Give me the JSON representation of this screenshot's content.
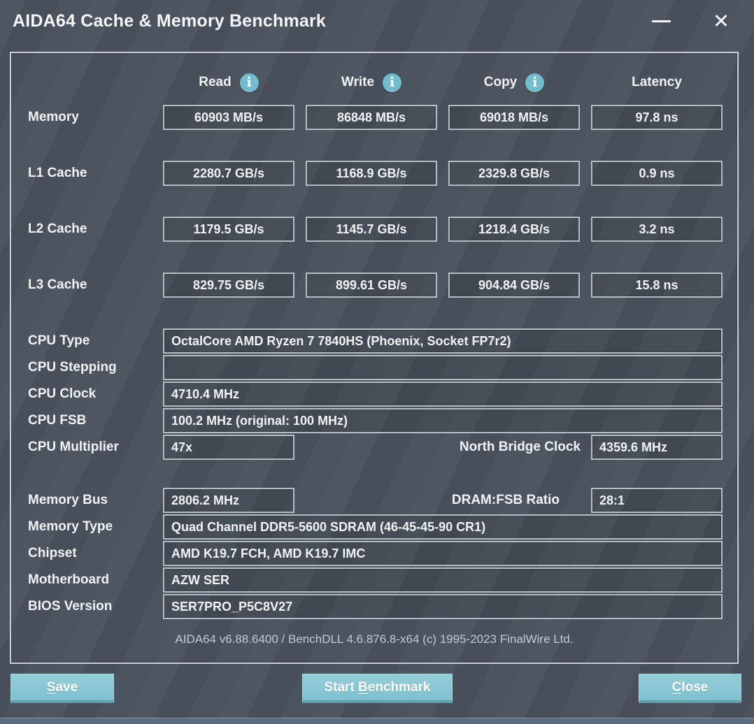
{
  "window": {
    "title": "AIDA64 Cache & Memory Benchmark"
  },
  "icons": {
    "info_glyph": "i",
    "close_glyph": "✕"
  },
  "colors": {
    "window_background": "#4a525d",
    "panel_border": "#ccd2d8",
    "box_border": "#b7bec6",
    "info_icon": "#72bccd",
    "button_teal": "#7fc1cf",
    "button_shadow": "#5f9fae",
    "text": "#f0f3f5",
    "credit_text": "#c3cad2"
  },
  "benchmark": {
    "columns": [
      {
        "label": "Read"
      },
      {
        "label": "Write"
      },
      {
        "label": "Copy"
      },
      {
        "label": "Latency"
      }
    ],
    "rows": [
      {
        "label": "Memory",
        "read": "60903 MB/s",
        "write": "86848 MB/s",
        "copy": "69018 MB/s",
        "latency": "97.8 ns"
      },
      {
        "label": "L1 Cache",
        "read": "2280.7 GB/s",
        "write": "1168.9 GB/s",
        "copy": "2329.8 GB/s",
        "latency": "0.9 ns"
      },
      {
        "label": "L2 Cache",
        "read": "1179.5 GB/s",
        "write": "1145.7 GB/s",
        "copy": "1218.4 GB/s",
        "latency": "3.2 ns"
      },
      {
        "label": "L3 Cache",
        "read": "829.75 GB/s",
        "write": "899.61 GB/s",
        "copy": "904.84 GB/s",
        "latency": "15.8 ns"
      }
    ]
  },
  "system": {
    "cpu_type": {
      "label": "CPU Type",
      "value": "OctalCore AMD Ryzen 7 7840HS  (Phoenix, Socket FP7r2)"
    },
    "cpu_stepping": {
      "label": "CPU Stepping",
      "value": ""
    },
    "cpu_clock": {
      "label": "CPU Clock",
      "value": "4710.4 MHz"
    },
    "cpu_fsb": {
      "label": "CPU FSB",
      "value": "100.2 MHz  (original: 100 MHz)"
    },
    "cpu_multiplier": {
      "label": "CPU Multiplier",
      "value": "47x"
    },
    "north_bridge_clock": {
      "label": "North Bridge Clock",
      "value": "4359.6 MHz"
    },
    "memory_bus": {
      "label": "Memory Bus",
      "value": "2806.2 MHz"
    },
    "dram_fsb_ratio": {
      "label": "DRAM:FSB Ratio",
      "value": "28:1"
    },
    "memory_type": {
      "label": "Memory Type",
      "value": "Quad Channel DDR5-5600 SDRAM  (46-45-45-90 CR1)"
    },
    "chipset": {
      "label": "Chipset",
      "value": "AMD K19.7 FCH, AMD K19.7 IMC"
    },
    "motherboard": {
      "label": "Motherboard",
      "value": "AZW SER"
    },
    "bios_version": {
      "label": "BIOS Version",
      "value": "SER7PRO_P5C8V27"
    }
  },
  "footer": {
    "credit": "AIDA64 v6.88.6400 / BenchDLL 4.6.876.8-x64  (c) 1995-2023 FinalWire Ltd."
  },
  "buttons": {
    "save": {
      "pre": "",
      "key": "S",
      "rest": "ave"
    },
    "start_benchmark": {
      "pre": "Start ",
      "key": "B",
      "rest": "enchmark"
    },
    "close": {
      "pre": "",
      "key": "C",
      "rest": "lose"
    }
  }
}
